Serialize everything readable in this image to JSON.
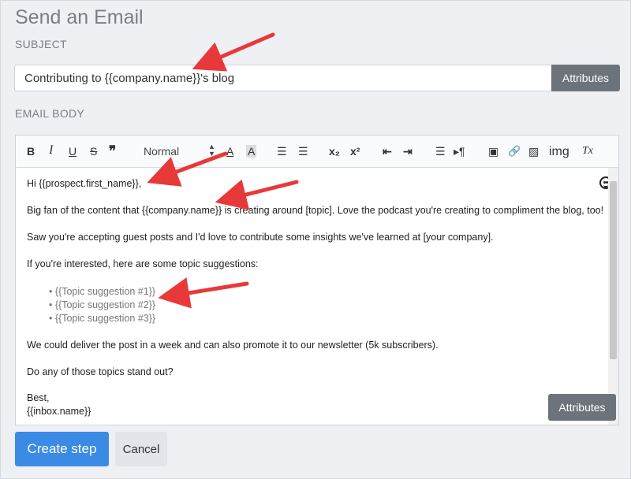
{
  "header": {
    "title": "Send an Email"
  },
  "subject": {
    "label": "SUBJECT",
    "value": "Contributing to {{company.name}}'s blog",
    "attributes_label": "Attributes"
  },
  "email_body": {
    "label": "EMAIL BODY",
    "toolbar": {
      "bold": "B",
      "italic": "I",
      "underline": "U",
      "strike": "S",
      "quote": "❞",
      "format": "Normal",
      "caret": "▲▼",
      "text_color": "A",
      "background_color": "A",
      "ordered_list": "☰",
      "bullet_list": "☰",
      "subscript": "x₂",
      "superscript": "x²",
      "outdent": "⇤",
      "indent": "⇥",
      "align": "☰",
      "direction": "▸¶",
      "video": "▣",
      "link": "🔗",
      "image": "▨",
      "img": "img",
      "clear_format": "Tx"
    },
    "lines": {
      "greeting": "Hi {{prospect.first_name}},",
      "p1": "Big fan of the content that {{company.name}} is creating around [topic]. Love the podcast you're creating to compliment the blog, too!",
      "p2": "Saw you're accepting guest posts and I'd love to contribute some insights we've learned at [your company].",
      "p3": "If you're interested, here are some topic suggestions:",
      "topics": [
        "• {{Topic suggestion #1}}",
        "• {{Topic suggestion #2}}",
        "• {{Topic suggestion #3}}"
      ],
      "p4": "We could deliver the post in a week and can also promote it to our newsletter (5k subscribers).",
      "p5": "Do any of those topics stand out?",
      "signoff": "Best,",
      "signature": "{{inbox.name}}"
    },
    "attributes_label": "Attributes"
  },
  "actions": {
    "create": "Create step",
    "cancel": "Cancel"
  },
  "colors": {
    "primary": "#3b8be4",
    "annotation_arrow": "#e8393a",
    "secondary_button": "#6c737b"
  }
}
